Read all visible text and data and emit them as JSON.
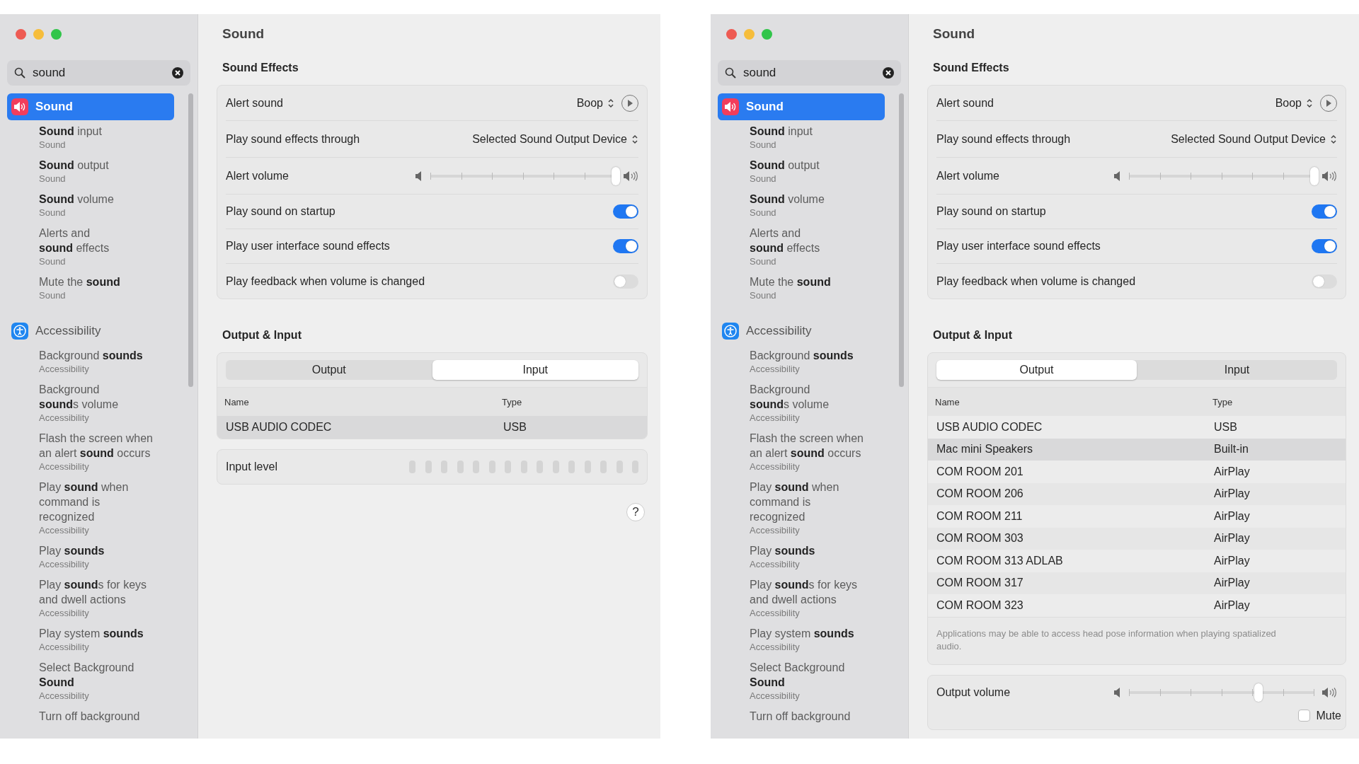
{
  "windows": [
    {
      "sidebar": {
        "search": {
          "value": "sound"
        },
        "groups": [
          {
            "kind": "sound",
            "title": "Sound",
            "selected": true,
            "results": [
              {
                "title": "**Sound** input",
                "subtitle": "Sound"
              },
              {
                "title": "**Sound** output",
                "subtitle": "Sound"
              },
              {
                "title": "**Sound** volume",
                "subtitle": "Sound"
              },
              {
                "title": "Alerts and\n**sound** effects",
                "subtitle": "Sound"
              },
              {
                "title": "Mute the **sound**",
                "subtitle": "Sound"
              }
            ]
          },
          {
            "kind": "accessibility",
            "title": "Accessibility",
            "selected": false,
            "results": [
              {
                "title": "Background **sounds**",
                "subtitle": "Accessibility"
              },
              {
                "title": "Background\n**sound**s volume",
                "subtitle": "Accessibility"
              },
              {
                "title": "Flash the screen when\nan alert **sound** occurs",
                "subtitle": "Accessibility"
              },
              {
                "title": "Play **sound** when\ncommand is\nrecognized",
                "subtitle": "Accessibility"
              },
              {
                "title": "Play **sounds**",
                "subtitle": "Accessibility"
              },
              {
                "title": "Play **sound**s for keys\nand dwell actions",
                "subtitle": "Accessibility"
              },
              {
                "title": "Play system **sounds**",
                "subtitle": "Accessibility"
              },
              {
                "title": "Select Background\n**Sound**",
                "subtitle": "Accessibility"
              },
              {
                "title": "Turn off background"
              }
            ]
          }
        ]
      },
      "pane": {
        "title": "Sound",
        "effects_title": "Sound Effects",
        "effects": [
          {
            "kind": "popup",
            "label": "Alert sound",
            "value": "Boop",
            "play_button": true
          },
          {
            "kind": "popup",
            "label": "Play sound effects through",
            "value": "Selected Sound Output Device"
          },
          {
            "kind": "slider",
            "label": "Alert volume",
            "level": 1.0
          },
          {
            "kind": "toggle",
            "label": "Play sound on startup",
            "on": true
          },
          {
            "kind": "toggle",
            "label": "Play user interface sound effects",
            "on": true
          },
          {
            "kind": "toggle",
            "label": "Play feedback when volume is changed",
            "on": false
          }
        ],
        "io_title": "Output & Input",
        "tabs": [
          {
            "label": "Output",
            "selected": false
          },
          {
            "label": "Input",
            "selected": true
          }
        ],
        "table": {
          "columns": [
            "Name",
            "Type"
          ],
          "rows": [
            {
              "name": "USB AUDIO  CODEC",
              "type": "USB",
              "selected": true
            }
          ]
        },
        "input_level": {
          "label": "Input level"
        },
        "help": "?"
      }
    },
    {
      "sidebar": {
        "search": {
          "value": "sound"
        },
        "groups": [
          {
            "kind": "sound",
            "title": "Sound",
            "selected": true,
            "results": [
              {
                "title": "**Sound** input",
                "subtitle": "Sound"
              },
              {
                "title": "**Sound** output",
                "subtitle": "Sound"
              },
              {
                "title": "**Sound** volume",
                "subtitle": "Sound"
              },
              {
                "title": "Alerts and\n**sound** effects",
                "subtitle": "Sound"
              },
              {
                "title": "Mute the **sound**",
                "subtitle": "Sound"
              }
            ]
          },
          {
            "kind": "accessibility",
            "title": "Accessibility",
            "selected": false,
            "results": [
              {
                "title": "Background **sounds**",
                "subtitle": "Accessibility"
              },
              {
                "title": "Background\n**sound**s volume",
                "subtitle": "Accessibility"
              },
              {
                "title": "Flash the screen when\nan alert **sound** occurs",
                "subtitle": "Accessibility"
              },
              {
                "title": "Play **sound** when\ncommand is\nrecognized",
                "subtitle": "Accessibility"
              },
              {
                "title": "Play **sounds**",
                "subtitle": "Accessibility"
              },
              {
                "title": "Play **sound**s for keys\nand dwell actions",
                "subtitle": "Accessibility"
              },
              {
                "title": "Play system **sounds**",
                "subtitle": "Accessibility"
              },
              {
                "title": "Select Background\n**Sound**",
                "subtitle": "Accessibility"
              },
              {
                "title": "Turn off background"
              }
            ]
          }
        ]
      },
      "pane": {
        "title": "Sound",
        "effects_title": "Sound Effects",
        "effects": [
          {
            "kind": "popup",
            "label": "Alert sound",
            "value": "Boop",
            "play_button": true
          },
          {
            "kind": "popup",
            "label": "Play sound effects through",
            "value": "Selected Sound Output Device"
          },
          {
            "kind": "slider",
            "label": "Alert volume",
            "level": 1.0
          },
          {
            "kind": "toggle",
            "label": "Play sound on startup",
            "on": true
          },
          {
            "kind": "toggle",
            "label": "Play user interface sound effects",
            "on": true
          },
          {
            "kind": "toggle",
            "label": "Play feedback when volume is changed",
            "on": false
          }
        ],
        "io_title": "Output & Input",
        "tabs": [
          {
            "label": "Output",
            "selected": true
          },
          {
            "label": "Input",
            "selected": false
          }
        ],
        "table": {
          "columns": [
            "Name",
            "Type"
          ],
          "rows": [
            {
              "name": "USB AUDIO  CODEC",
              "type": "USB",
              "selected": false
            },
            {
              "name": "Mac mini Speakers",
              "type": "Built-in",
              "selected": true
            },
            {
              "name": "COM ROOM 201",
              "type": "AirPlay",
              "selected": false
            },
            {
              "name": "COM ROOM 206",
              "type": "AirPlay",
              "selected": false
            },
            {
              "name": "COM ROOM 211",
              "type": "AirPlay",
              "selected": false
            },
            {
              "name": "COM ROOM 303",
              "type": "AirPlay",
              "selected": false
            },
            {
              "name": "COM ROOM 313 ADLAB",
              "type": "AirPlay",
              "selected": false
            },
            {
              "name": "COM ROOM 317",
              "type": "AirPlay",
              "selected": false
            },
            {
              "name": "COM ROOM 323",
              "type": "AirPlay",
              "selected": false
            }
          ],
          "note": "Applications may be able to access head pose information when playing spatialized audio."
        },
        "output_volume": {
          "label": "Output volume",
          "level": 0.7,
          "mute": {
            "label": "Mute",
            "checked": false
          }
        }
      }
    }
  ]
}
